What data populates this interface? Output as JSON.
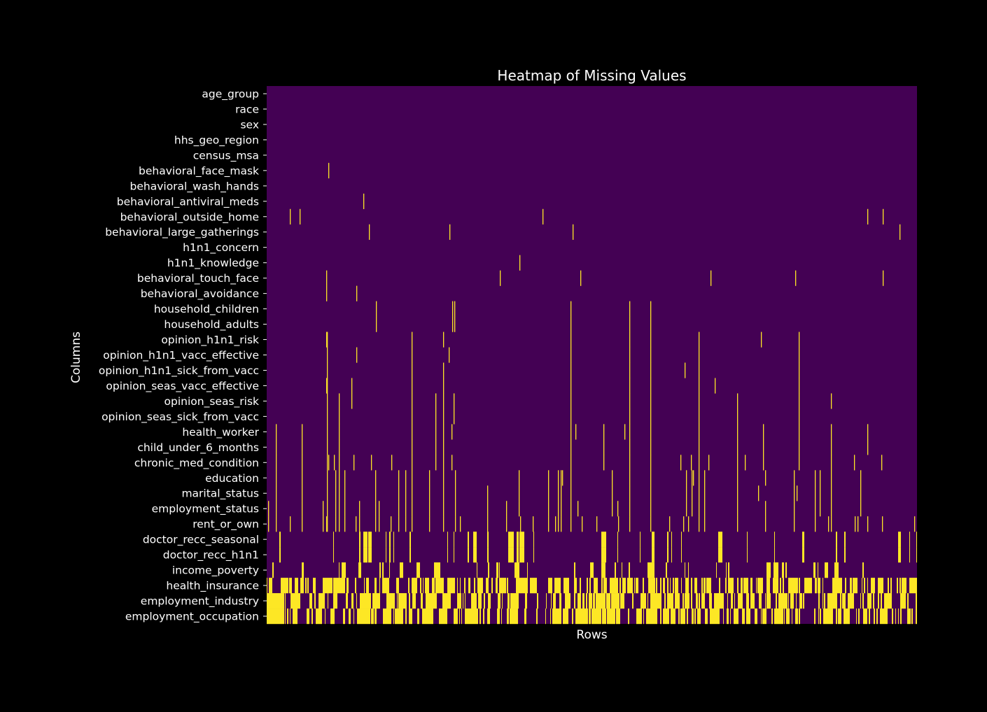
{
  "chart_data": {
    "type": "heatmap",
    "title": "Heatmap of Missing Values",
    "xlabel": "Rows",
    "ylabel": "Columns",
    "x_ticks": "none",
    "colormap": "viridis (binary: present / missing)",
    "colors": {
      "present": "#440154",
      "missing": "#fde725",
      "background": "#000000",
      "text": "#ffffff"
    },
    "legend": "none",
    "x_domain": [
      0,
      1
    ],
    "rows": [
      {
        "label": "age_group",
        "missing_at": [],
        "density": 0
      },
      {
        "label": "race",
        "missing_at": [],
        "density": 0
      },
      {
        "label": "sex",
        "missing_at": [],
        "density": 0
      },
      {
        "label": "hhs_geo_region",
        "missing_at": [],
        "density": 0
      },
      {
        "label": "census_msa",
        "missing_at": [],
        "density": 0
      },
      {
        "label": "behavioral_face_mask",
        "missing_at": [
          0.095
        ],
        "density": 0
      },
      {
        "label": "behavioral_wash_hands",
        "missing_at": [],
        "density": 0
      },
      {
        "label": "behavioral_antiviral_meds",
        "missing_at": [
          0.149
        ],
        "density": 0
      },
      {
        "label": "behavioral_outside_home",
        "missing_at": [
          0.036,
          0.051,
          0.424,
          0.924,
          0.947
        ],
        "density": 0
      },
      {
        "label": "behavioral_large_gatherings",
        "missing_at": [
          0.157,
          0.281,
          0.47,
          0.973
        ],
        "density": 0
      },
      {
        "label": "h1n1_concern",
        "missing_at": [],
        "density": 0
      },
      {
        "label": "h1n1_knowledge",
        "missing_at": [
          0.389
        ],
        "density": 0
      },
      {
        "label": "behavioral_touch_face",
        "missing_at": [
          0.092,
          0.358,
          0.482,
          0.682,
          0.813,
          0.947
        ],
        "density": 0
      },
      {
        "label": "behavioral_avoidance",
        "missing_at": [
          0.091,
          0.138
        ],
        "density": 0
      },
      {
        "label": "household_children",
        "missing_at": [
          0.168,
          0.285,
          0.288,
          0.467,
          0.558,
          0.59
        ],
        "density": 0
      },
      {
        "label": "household_adults",
        "missing_at": [
          0.168,
          0.285,
          0.288,
          0.467,
          0.558,
          0.59
        ],
        "density": 0
      },
      {
        "label": "opinion_h1n1_risk",
        "missing_at": [
          0.092,
          0.093,
          0.223,
          0.271,
          0.467,
          0.558,
          0.59,
          0.664,
          0.76,
          0.818
        ],
        "density": 0
      },
      {
        "label": "opinion_h1n1_vacc_effective",
        "missing_at": [
          0.093,
          0.138,
          0.223,
          0.28,
          0.467,
          0.558,
          0.59,
          0.664,
          0.818
        ],
        "density": 0
      },
      {
        "label": "opinion_h1n1_sick_from_vacc",
        "missing_at": [
          0.093,
          0.223,
          0.271,
          0.467,
          0.558,
          0.59,
          0.664,
          0.643,
          0.818
        ],
        "density": 0
      },
      {
        "label": "opinion_seas_vacc_effective",
        "missing_at": [
          0.092,
          0.093,
          0.13,
          0.223,
          0.271,
          0.467,
          0.558,
          0.59,
          0.664,
          0.689,
          0.818
        ],
        "density": 0
      },
      {
        "label": "opinion_seas_risk",
        "missing_at": [
          0.093,
          0.111,
          0.13,
          0.223,
          0.259,
          0.271,
          0.287,
          0.467,
          0.558,
          0.59,
          0.664,
          0.723,
          0.818,
          0.868
        ],
        "density": 0
      },
      {
        "label": "opinion_seas_sick_from_vacc",
        "missing_at": [
          0.093,
          0.111,
          0.223,
          0.259,
          0.271,
          0.287,
          0.467,
          0.558,
          0.59,
          0.664,
          0.723,
          0.818
        ],
        "density": 0
      },
      {
        "label": "health_worker",
        "missing_at": [
          0.014,
          0.054,
          0.093,
          0.111,
          0.223,
          0.259,
          0.271,
          0.284,
          0.467,
          0.475,
          0.518,
          0.55,
          0.558,
          0.59,
          0.664,
          0.723,
          0.763,
          0.818,
          0.868,
          0.924
        ],
        "density": 0
      },
      {
        "label": "child_under_6_months",
        "missing_at": [
          0.014,
          0.054,
          0.093,
          0.111,
          0.223,
          0.259,
          0.271,
          0.467,
          0.518,
          0.558,
          0.59,
          0.664,
          0.723,
          0.763,
          0.818,
          0.868,
          0.924
        ],
        "density": 0
      },
      {
        "label": "chronic_med_condition",
        "missing_at": [
          0.014,
          0.054,
          0.093,
          0.095,
          0.103,
          0.111,
          0.134,
          0.16,
          0.192,
          0.223,
          0.259,
          0.271,
          0.284,
          0.467,
          0.518,
          0.558,
          0.59,
          0.636,
          0.652,
          0.664,
          0.679,
          0.723,
          0.735,
          0.763,
          0.818,
          0.868,
          0.903,
          0.945
        ],
        "density": 0
      },
      {
        "label": "education",
        "missing_at": [
          0.014,
          0.054,
          0.093,
          0.105,
          0.111,
          0.119,
          0.167,
          0.202,
          0.213,
          0.223,
          0.25,
          0.271,
          0.29,
          0.387,
          0.433,
          0.448,
          0.452,
          0.454,
          0.467,
          0.531,
          0.558,
          0.59,
          0.645,
          0.653,
          0.656,
          0.664,
          0.673,
          0.723,
          0.766,
          0.811,
          0.843,
          0.85,
          0.868,
          0.913
        ],
        "density": 0
      },
      {
        "label": "marital_status",
        "missing_at": [
          0.014,
          0.054,
          0.093,
          0.105,
          0.111,
          0.119,
          0.167,
          0.202,
          0.213,
          0.223,
          0.25,
          0.271,
          0.29,
          0.339,
          0.387,
          0.433,
          0.448,
          0.452,
          0.467,
          0.531,
          0.558,
          0.59,
          0.645,
          0.653,
          0.664,
          0.673,
          0.723,
          0.756,
          0.811,
          0.815,
          0.843,
          0.85,
          0.868,
          0.913
        ],
        "density": 0
      },
      {
        "label": "employment_status",
        "missing_at": [
          0.002,
          0.014,
          0.054,
          0.086,
          0.093,
          0.105,
          0.111,
          0.119,
          0.142,
          0.167,
          0.172,
          0.202,
          0.213,
          0.223,
          0.25,
          0.271,
          0.29,
          0.339,
          0.368,
          0.387,
          0.433,
          0.448,
          0.452,
          0.467,
          0.478,
          0.531,
          0.539,
          0.558,
          0.59,
          0.645,
          0.653,
          0.664,
          0.673,
          0.723,
          0.766,
          0.811,
          0.843,
          0.85,
          0.868,
          0.913
        ],
        "density": 0
      },
      {
        "label": "rent_or_own",
        "missing_at": [
          0.002,
          0.014,
          0.036,
          0.054,
          0.086,
          0.092,
          0.093,
          0.105,
          0.111,
          0.119,
          0.137,
          0.142,
          0.167,
          0.172,
          0.19,
          0.202,
          0.213,
          0.223,
          0.25,
          0.271,
          0.29,
          0.297,
          0.339,
          0.368,
          0.39,
          0.409,
          0.433,
          0.443,
          0.448,
          0.452,
          0.467,
          0.484,
          0.507,
          0.54,
          0.558,
          0.59,
          0.619,
          0.64,
          0.648,
          0.664,
          0.673,
          0.723,
          0.766,
          0.811,
          0.843,
          0.863,
          0.868,
          0.904,
          0.908,
          0.924,
          0.946,
          0.996
        ],
        "density": 0
      },
      {
        "label": "doctor_recc_seasonal",
        "missing_at": [],
        "density": 0.17
      },
      {
        "label": "doctor_recc_h1n1",
        "missing_at": [],
        "density": 0.17
      },
      {
        "label": "income_poverty",
        "missing_at": [],
        "density": 0.2
      },
      {
        "label": "health_insurance",
        "missing_at": [],
        "density": 0.55
      },
      {
        "label": "employment_industry",
        "missing_at": [],
        "density": 0.6
      },
      {
        "label": "employment_occupation",
        "missing_at": [],
        "density": 0.62
      }
    ],
    "row_groups_sharing_pattern": [
      [
        "doctor_recc_seasonal",
        "doctor_recc_h1n1"
      ],
      [
        "employment_industry",
        "employment_occupation"
      ]
    ]
  }
}
